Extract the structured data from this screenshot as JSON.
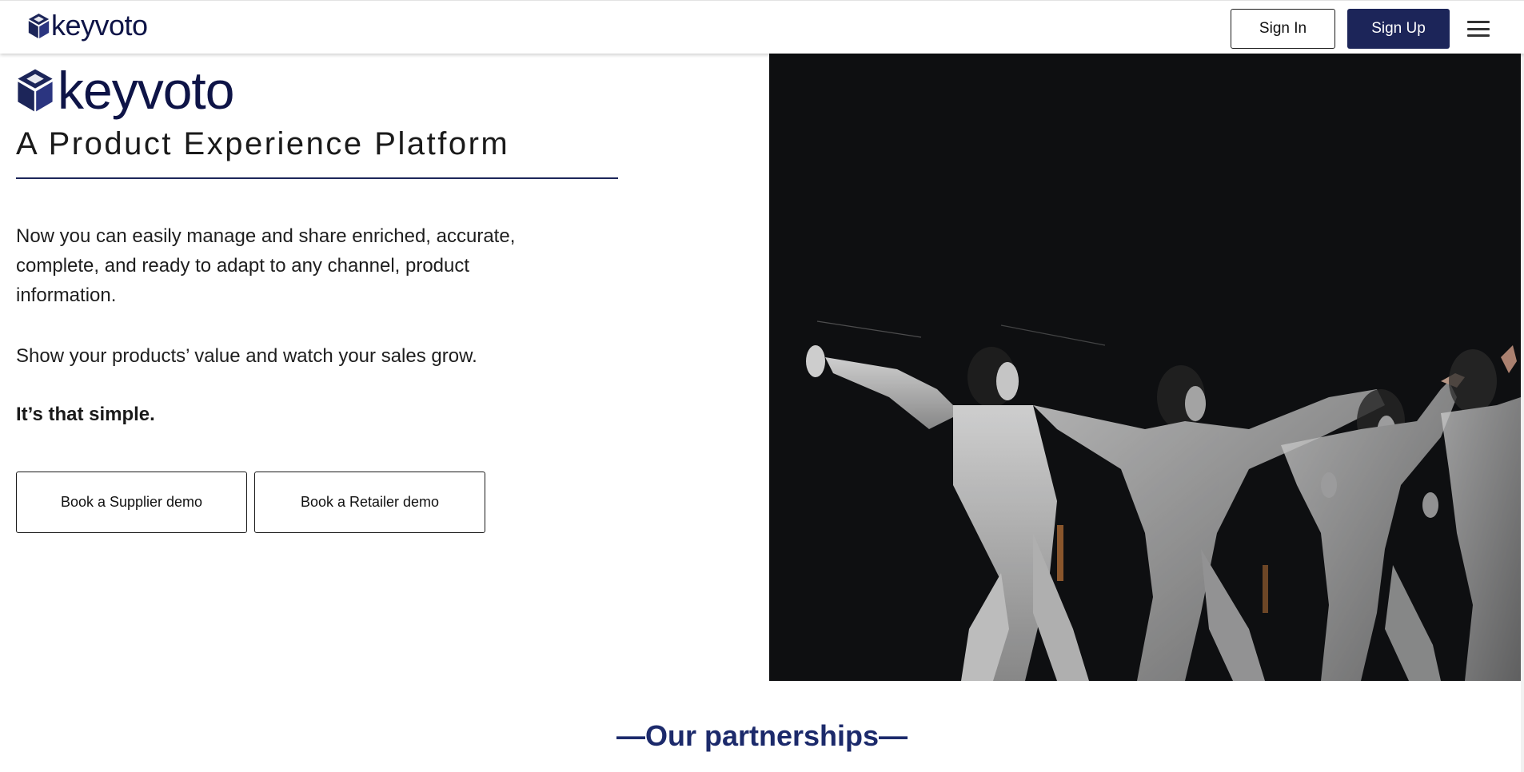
{
  "header": {
    "brand": "keyvoto",
    "sign_in_label": "Sign In",
    "sign_up_label": "Sign Up",
    "menu_icon": "hamburger-menu-icon"
  },
  "hero": {
    "brand": "keyvoto",
    "tagline": "A Product Experience Platform",
    "intro": "Now you can easily manage and share enriched, accurate, complete, and ready to adapt to any channel, product information.",
    "value_line": "Show your products’ value and watch your sales grow.",
    "simple_line": "It’s that simple.",
    "supplier_demo_label": "Book a Supplier demo",
    "retailer_demo_label": "Book a Retailer demo",
    "image_icon": "fencer-motion-sequence-photo"
  },
  "partnerships": {
    "heading": "—Our partnerships—"
  },
  "colors": {
    "brand_navy": "#0e1447",
    "button_navy": "#1c2559",
    "heading_blue": "#1c2a6b",
    "photo_background": "#0e0f11"
  }
}
